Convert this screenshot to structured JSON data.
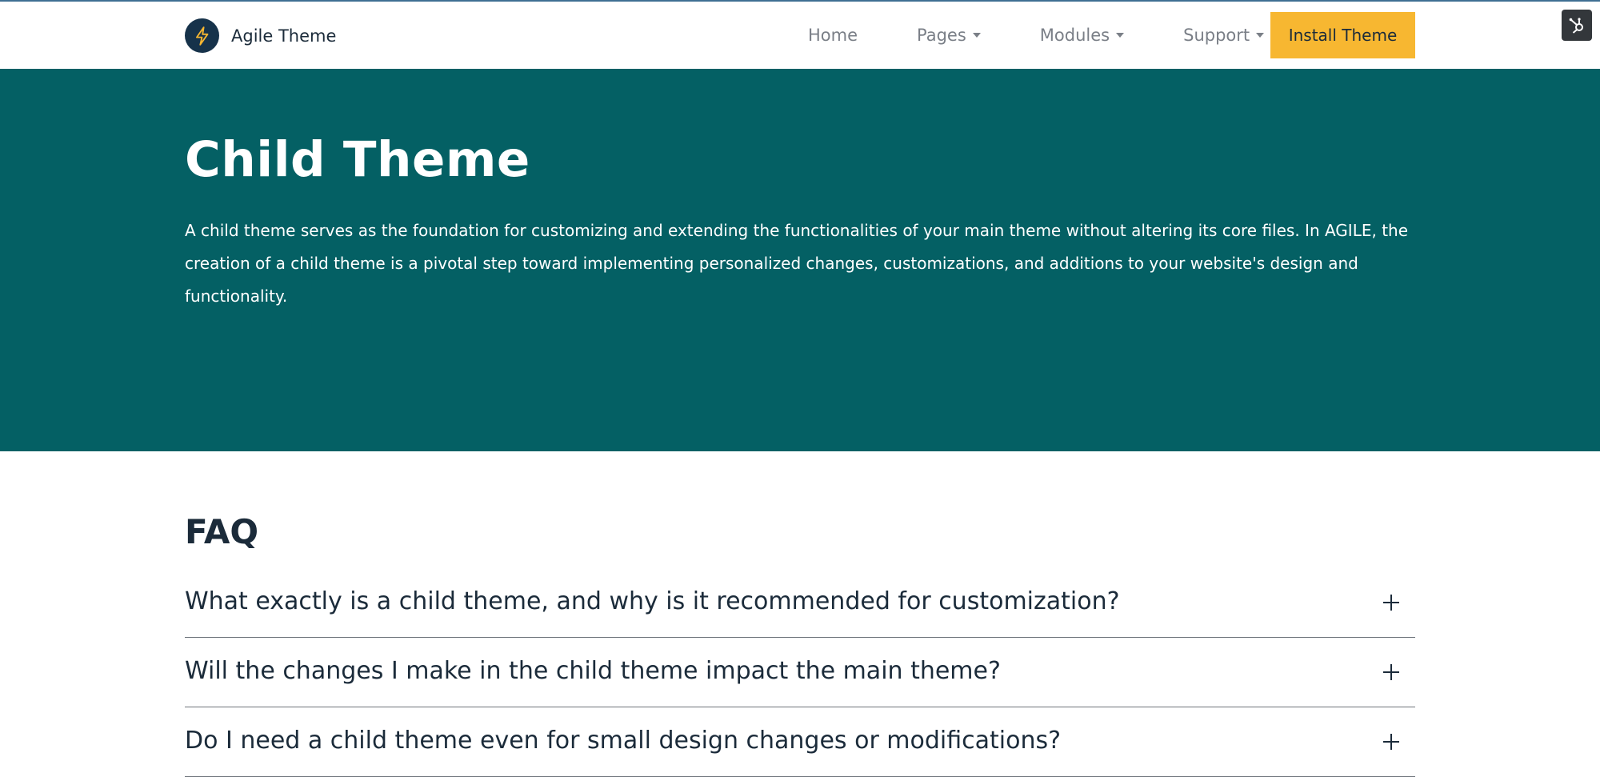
{
  "header": {
    "brand_name": "Agile Theme",
    "logo_icon": "lightning-bolt-icon",
    "nav": [
      {
        "label": "Home",
        "has_dropdown": false
      },
      {
        "label": "Pages",
        "has_dropdown": true
      },
      {
        "label": "Modules",
        "has_dropdown": true
      },
      {
        "label": "Support",
        "has_dropdown": true
      }
    ],
    "cta_label": "Install Theme",
    "hub_icon": "hubspot-sprocket-icon"
  },
  "hero": {
    "title": "Child Theme",
    "description": "A child theme serves as the foundation for customizing and extending the functionalities of your main theme without altering its core files. In AGILE, the creation of a child theme is a pivotal step toward implementing personalized changes, customizations, and additions to your website's design and functionality."
  },
  "faq": {
    "title": "FAQ",
    "items": [
      {
        "question": "What exactly is a child theme, and why is it recommended for customization?"
      },
      {
        "question": "Will the changes I make in the child theme impact the main theme?"
      },
      {
        "question": "Do I need a child theme even for small design changes or modifications?"
      }
    ]
  },
  "colors": {
    "hero_bg": "#046064",
    "cta_bg": "#f7b731",
    "logo_bg": "#16324a",
    "text_dark": "#1b2b3a",
    "nav_text": "#7a7f87"
  }
}
